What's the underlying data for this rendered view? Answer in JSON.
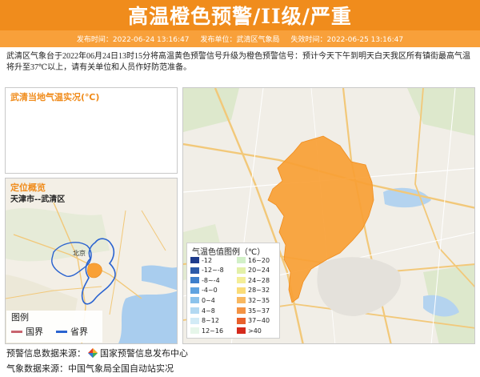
{
  "banner": {
    "title": "高温橙色预警/II级/严重"
  },
  "meta": {
    "publish_time": "发布时间：2022-06-24 13:16:47",
    "publisher": "发布单位：武清区气象局",
    "expire_time": "失效时间：2022-06-25 13:16:47"
  },
  "description": "武清区气象台于2022年06月24日13时15分将高温黄色预警信号升级为橙色预警信号：预计今天下午到明天白天我区所有镇街最高气温将升至37℃以上，请有关单位和人员作好防范准备。",
  "panel_temp": {
    "heading": "武清当地气温实况(℃)"
  },
  "panel_location": {
    "heading": "定位概览",
    "subheading": "天津市--武清区",
    "map_label_beijing": "北京",
    "legend": {
      "title": "图例",
      "country": "国界",
      "province": "省界"
    }
  },
  "temp_legend": {
    "title": "气温色值图例（℃）",
    "items": [
      {
        "label": "-12",
        "color": "#1f3c8c"
      },
      {
        "label": "16~20",
        "color": "#d2f0c8"
      },
      {
        "label": "-12~-8",
        "color": "#2c5aa8"
      },
      {
        "label": "20~24",
        "color": "#e3f0a8"
      },
      {
        "label": "-8~-4",
        "color": "#3e7fcb"
      },
      {
        "label": "24~28",
        "color": "#f4ee98"
      },
      {
        "label": "-4~0",
        "color": "#5fa3e0"
      },
      {
        "label": "28~32",
        "color": "#fadc78"
      },
      {
        "label": "0~4",
        "color": "#8cc3ec"
      },
      {
        "label": "32~35",
        "color": "#f8b860"
      },
      {
        "label": "4~8",
        "color": "#b3d9f2"
      },
      {
        "label": "35~37",
        "color": "#f39344"
      },
      {
        "label": "8~12",
        "color": "#d2ebf6"
      },
      {
        "label": "37~40",
        "color": "#e8602c"
      },
      {
        "label": "12~16",
        "color": "#e6f6ea"
      },
      {
        "label": ">40",
        "color": "#d42a1c"
      }
    ]
  },
  "sources": {
    "warning_source": "预警信息数据来源：",
    "warning_source_name": "国家预警信息发布中心",
    "weather_source": "气象数据来源：中国气象局全国自动站实况"
  },
  "colors": {
    "accent": "#f08c1c",
    "region_fill": "#f9a035",
    "country_line": "#c8646e",
    "province_line": "#2a63d0"
  }
}
